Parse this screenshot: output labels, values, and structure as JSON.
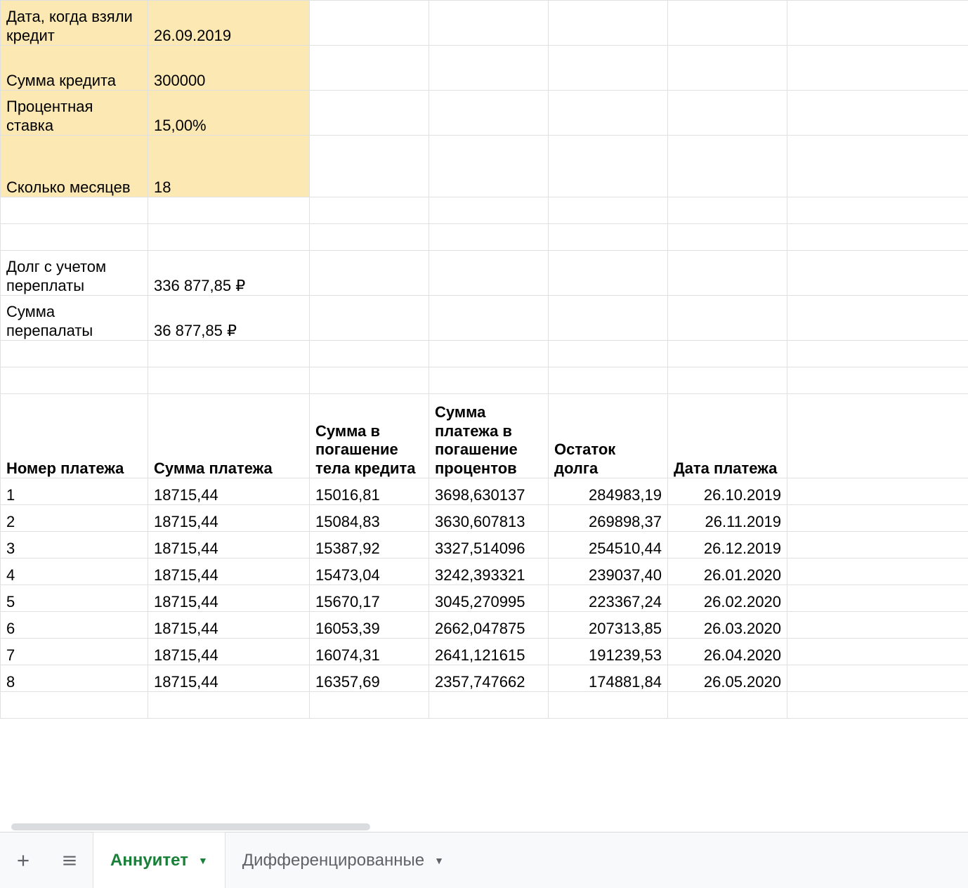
{
  "inputs": {
    "date_label": "Дата, когда взяли кредит",
    "date_value": "26.09.2019",
    "amount_label": "Сумма кредита",
    "amount_value": "300000",
    "rate_label": "Процентная ставка",
    "rate_value": "15,00%",
    "months_label": "Сколько месяцев",
    "months_value": "18"
  },
  "summary": {
    "total_label": "Долг с учетом переплаты",
    "total_value": "336 877,85 ₽",
    "overpay_label": "Сумма перепалаты",
    "overpay_value": "36 877,85 ₽"
  },
  "headers": {
    "c1": "Номер платежа",
    "c2": "Сумма платежа",
    "c3": "Сумма в погашение тела кредита",
    "c4": "Сумма платежа в погашение процентов",
    "c5": "Остаток долга",
    "c6": "Дата платежа"
  },
  "rows": [
    {
      "n": "1",
      "p": "18715,44",
      "body": "15016,81",
      "int": "3698,630137",
      "rest": "284983,19",
      "d": "26.10.2019"
    },
    {
      "n": "2",
      "p": "18715,44",
      "body": "15084,83",
      "int": "3630,607813",
      "rest": "269898,37",
      "d": "26.11.2019"
    },
    {
      "n": "3",
      "p": "18715,44",
      "body": "15387,92",
      "int": "3327,514096",
      "rest": "254510,44",
      "d": "26.12.2019"
    },
    {
      "n": "4",
      "p": "18715,44",
      "body": "15473,04",
      "int": "3242,393321",
      "rest": "239037,40",
      "d": "26.01.2020"
    },
    {
      "n": "5",
      "p": "18715,44",
      "body": "15670,17",
      "int": "3045,270995",
      "rest": "223367,24",
      "d": "26.02.2020"
    },
    {
      "n": "6",
      "p": "18715,44",
      "body": "16053,39",
      "int": "2662,047875",
      "rest": "207313,85",
      "d": "26.03.2020"
    },
    {
      "n": "7",
      "p": "18715,44",
      "body": "16074,31",
      "int": "2641,121615",
      "rest": "191239,53",
      "d": "26.04.2020"
    },
    {
      "n": "8",
      "p": "18715,44",
      "body": "16357,69",
      "int": "2357,747662",
      "rest": "174881,84",
      "d": "26.05.2020"
    }
  ],
  "tabs": {
    "active": "Аннуитет",
    "other": "Дифференцированные"
  }
}
